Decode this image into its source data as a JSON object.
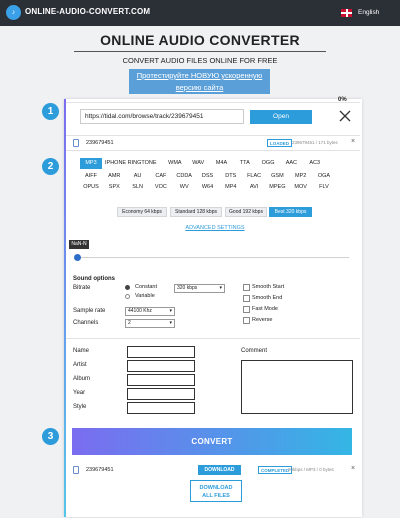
{
  "header": {
    "logo_text": "♪",
    "site_name": "ONLINE-AUDIO-CONVERT.COM",
    "language": "English"
  },
  "title": "ONLINE AUDIO CONVERTER",
  "subtitle": "CONVERT AUDIO FILES ONLINE FOR FREE",
  "promo": {
    "line1": "Протестируйте НОВУЮ ускоренную",
    "line2": "версию сайта"
  },
  "steps": [
    "1",
    "2",
    "3"
  ],
  "upload": {
    "progress_text": "0%",
    "progress": 0,
    "url_value": "https://tidal.com/browse/track/239679451",
    "open_label": "Open"
  },
  "source_file": {
    "name": "239679451",
    "status": "LOADED",
    "meta": "239679451 / 171 bytes"
  },
  "formats": [
    [
      "MP3",
      "IPHONE RINGTONE",
      "WMA",
      "WAV",
      "M4A",
      "TTA",
      "OGG",
      "AAC",
      "AC3"
    ],
    [
      "AIFF",
      "AMR",
      "AU",
      "CAF",
      "CDDA",
      "DSS",
      "DTS",
      "FLAC",
      "GSM",
      "MP2",
      "OGA"
    ],
    [
      "OPUS",
      "SPX",
      "SLN",
      "VOC",
      "WV",
      "W64",
      "MP4",
      "AVI",
      "MPEG",
      "MOV",
      "FLV"
    ]
  ],
  "selected_format": "MP3",
  "quality": [
    "Economy 64 kbps",
    "Standard 128 kbps",
    "Good 192 kbps",
    "Best 320 kbps"
  ],
  "selected_quality": "Best 320 kbps",
  "advanced_settings": "ADVANCED SETTINGS",
  "slider": {
    "tooltip": "NaN-N",
    "value": 0
  },
  "sound": {
    "heading": "Sound options",
    "bitrate_label": "Bitrate",
    "constant_label": "Constant",
    "variable_label": "Variable",
    "bitrate_value": "320 kbps",
    "sample_rate_label": "Sample rate",
    "sample_rate_value": "44100 Khz",
    "channels_label": "Channels",
    "channels_value": "2"
  },
  "effects": [
    "Smooth Start",
    "Smooth End",
    "Fast Mode",
    "Reverse"
  ],
  "tags": {
    "fields": [
      "Name",
      "Artist",
      "Album",
      "Year",
      "Style"
    ],
    "comment_label": "Comment"
  },
  "convert_label": "CONVERT",
  "result_file": {
    "name": "239679451",
    "download_label": "DOWNLOAD",
    "status": "COMPLETED",
    "meta": "20kbps / MP3 / 0 bytes"
  },
  "download_all": {
    "line1": "DOWNLOAD",
    "line2": "ALL FILES"
  },
  "colors": {
    "accent": "#2d9cdb",
    "topbar": "#2b2f36",
    "convert_start": "#7b6cf0",
    "convert_end": "#34b6e4"
  }
}
